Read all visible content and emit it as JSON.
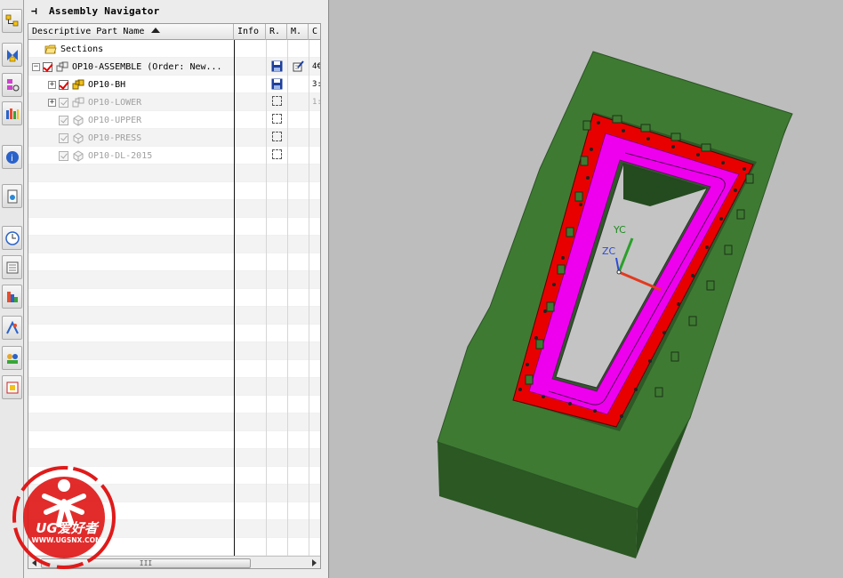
{
  "navigator": {
    "title": "Assembly Navigator",
    "columns": [
      "Descriptive Part Name",
      "Info",
      "R.",
      "M.",
      "C"
    ],
    "rows": [
      {
        "name": "Sections",
        "info": "",
        "col_c": ""
      },
      {
        "name": "OP10-ASSEMBLE (Order: New...",
        "info": "",
        "col_c": "4€"
      },
      {
        "name": "OP10-BH",
        "info": "",
        "col_c": "3:"
      },
      {
        "name": "OP10-LOWER",
        "info": "",
        "col_c": "1:"
      },
      {
        "name": "OP10-UPPER",
        "info": "",
        "col_c": ""
      },
      {
        "name": "OP10-PRESS",
        "info": "",
        "col_c": ""
      },
      {
        "name": "OP10-DL-2015",
        "info": "",
        "col_c": ""
      }
    ],
    "scroll_grip": "III"
  },
  "resource_bar": {
    "icons": [
      "assembly-navigator-icon",
      "constraint-navigator-icon",
      "part-navigator-icon",
      "reuse-library-icon",
      "hd3d-tools-icon",
      "web-browser-icon",
      "history-icon",
      "process-studio-icon",
      "roles-icon",
      "system-scenes-icon",
      "teamcenter-icon",
      "palette-icon"
    ]
  },
  "viewport": {
    "axis_labels": {
      "yc": "YC",
      "zc": "ZC"
    },
    "colors": {
      "base": "#3f7a33",
      "holder": "#e80000",
      "ring": "#ee00ee",
      "background": "#bdbdbd"
    }
  },
  "watermark": {
    "text": "UG爱好者",
    "url": "WWW.UGSNX.COM",
    "color": "#e01a1a"
  }
}
